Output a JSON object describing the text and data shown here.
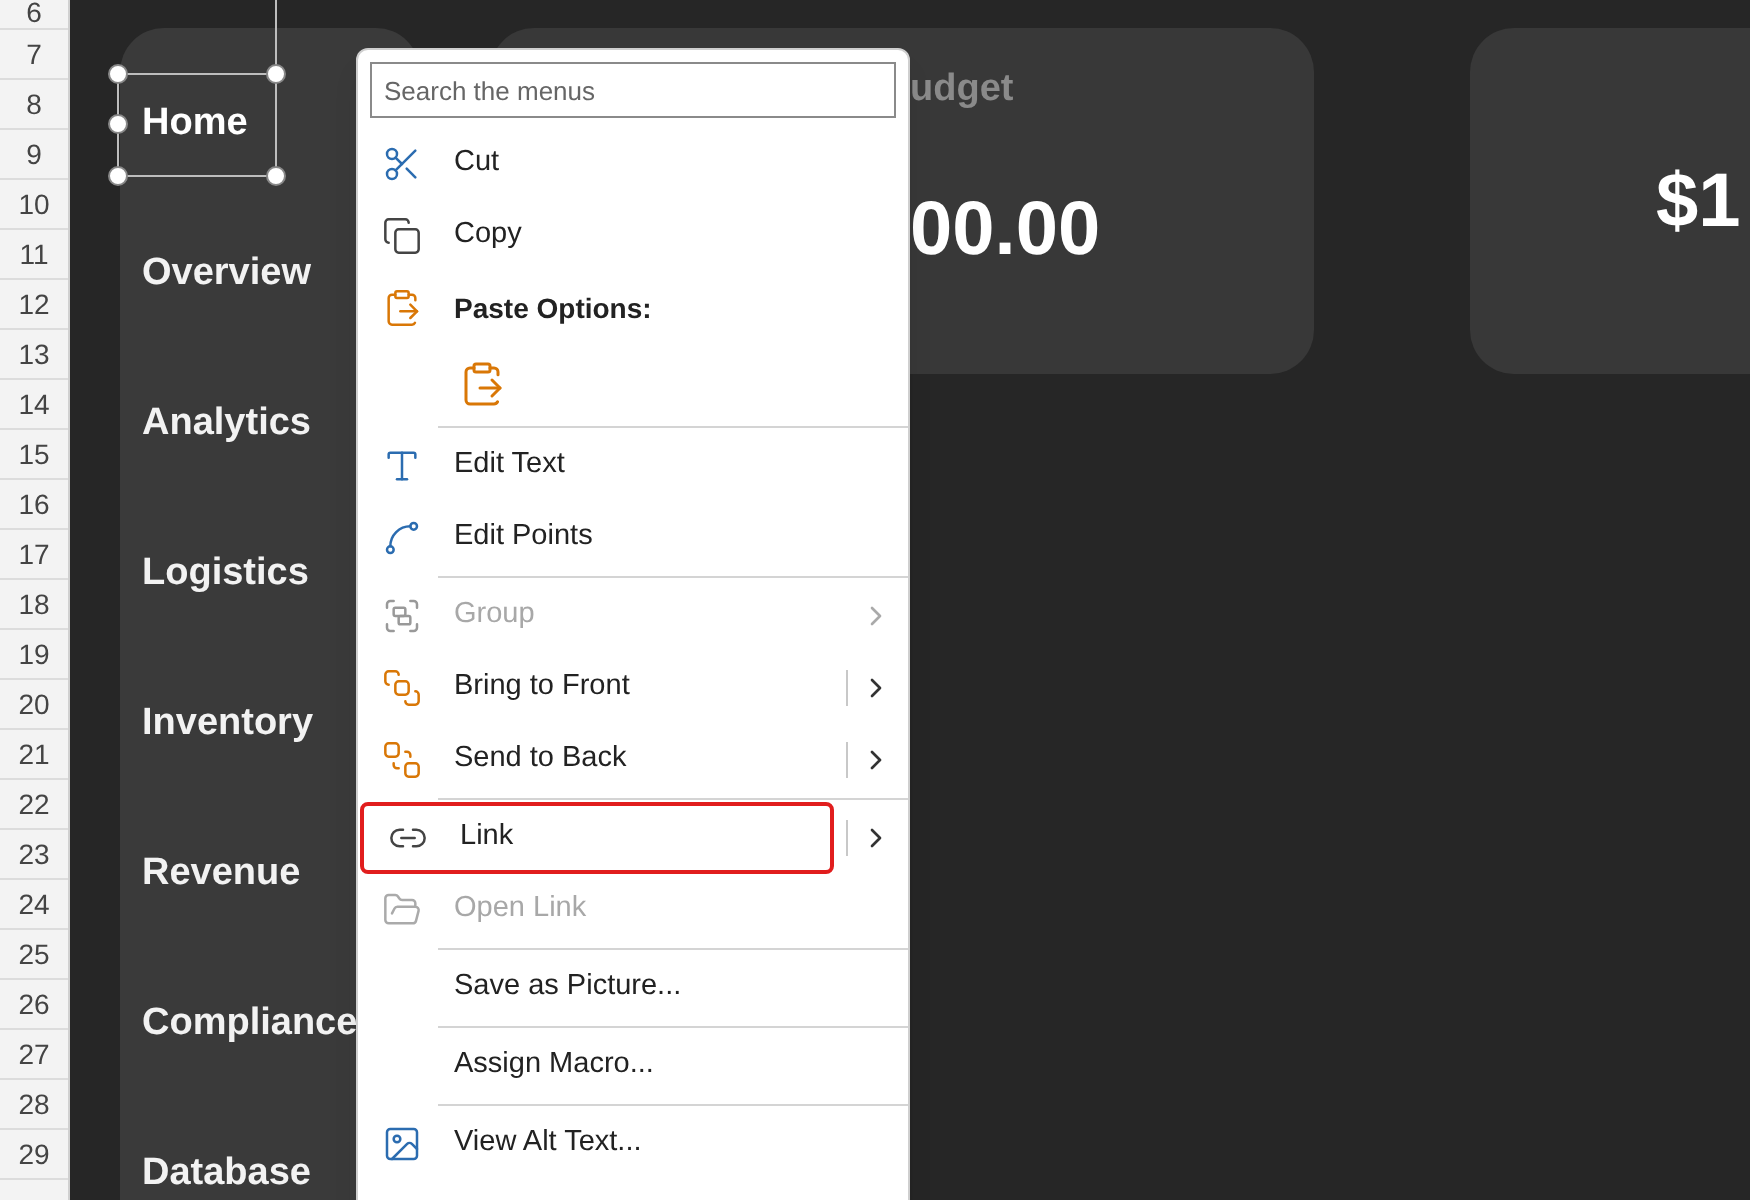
{
  "row_headers": [
    "6",
    "7",
    "8",
    "9",
    "10",
    "11",
    "12",
    "13",
    "14",
    "15",
    "16",
    "17",
    "18",
    "19",
    "20",
    "21",
    "22",
    "23",
    "24",
    "25",
    "26",
    "27",
    "28",
    "29"
  ],
  "sidebar": {
    "items": [
      {
        "label": "Home",
        "selected": true
      },
      {
        "label": "Overview",
        "selected": false
      },
      {
        "label": "Analytics",
        "selected": false
      },
      {
        "label": "Logistics",
        "selected": false
      },
      {
        "label": "Inventory",
        "selected": false
      },
      {
        "label": "Revenue",
        "selected": false
      },
      {
        "label": "Compliance",
        "selected": false
      },
      {
        "label": "Database",
        "selected": false
      }
    ]
  },
  "cards": [
    {
      "title": "udget",
      "value": "00.00"
    },
    {
      "value": "$1"
    }
  ],
  "context_menu": {
    "search": {
      "placeholder": "Search the menus"
    },
    "items": [
      {
        "kind": "command",
        "label": "Cut",
        "disabled": false,
        "submenu": false,
        "split": false,
        "highlighted": false
      },
      {
        "kind": "command",
        "label": "Copy",
        "disabled": false,
        "submenu": false,
        "split": false,
        "highlighted": false
      },
      {
        "kind": "header",
        "label": "Paste Options:"
      },
      {
        "kind": "paste"
      },
      {
        "kind": "separator"
      },
      {
        "kind": "command",
        "label": "Edit Text",
        "disabled": false,
        "submenu": false,
        "split": false,
        "highlighted": false
      },
      {
        "kind": "command",
        "label": "Edit Points",
        "disabled": false,
        "submenu": false,
        "split": false,
        "highlighted": false
      },
      {
        "kind": "separator"
      },
      {
        "kind": "command",
        "label": "Group",
        "disabled": true,
        "submenu": true,
        "split": false,
        "highlighted": false
      },
      {
        "kind": "command",
        "label": "Bring to Front",
        "disabled": false,
        "submenu": true,
        "split": true,
        "highlighted": false
      },
      {
        "kind": "command",
        "label": "Send to Back",
        "disabled": false,
        "submenu": true,
        "split": true,
        "highlighted": false
      },
      {
        "kind": "separator"
      },
      {
        "kind": "command",
        "label": "Link",
        "disabled": false,
        "submenu": true,
        "split": true,
        "highlighted": true
      },
      {
        "kind": "command",
        "label": "Open Link",
        "disabled": true,
        "submenu": false,
        "split": false,
        "highlighted": false
      },
      {
        "kind": "separator"
      },
      {
        "kind": "command",
        "label": "Save as Picture...",
        "disabled": false,
        "submenu": false,
        "split": false,
        "highlighted": false
      },
      {
        "kind": "separator"
      },
      {
        "kind": "command",
        "label": "Assign Macro...",
        "disabled": false,
        "submenu": false,
        "split": false,
        "highlighted": false
      },
      {
        "kind": "separator"
      },
      {
        "kind": "command",
        "label": "View Alt Text...",
        "disabled": false,
        "submenu": false,
        "split": false,
        "highlighted": false
      }
    ]
  }
}
